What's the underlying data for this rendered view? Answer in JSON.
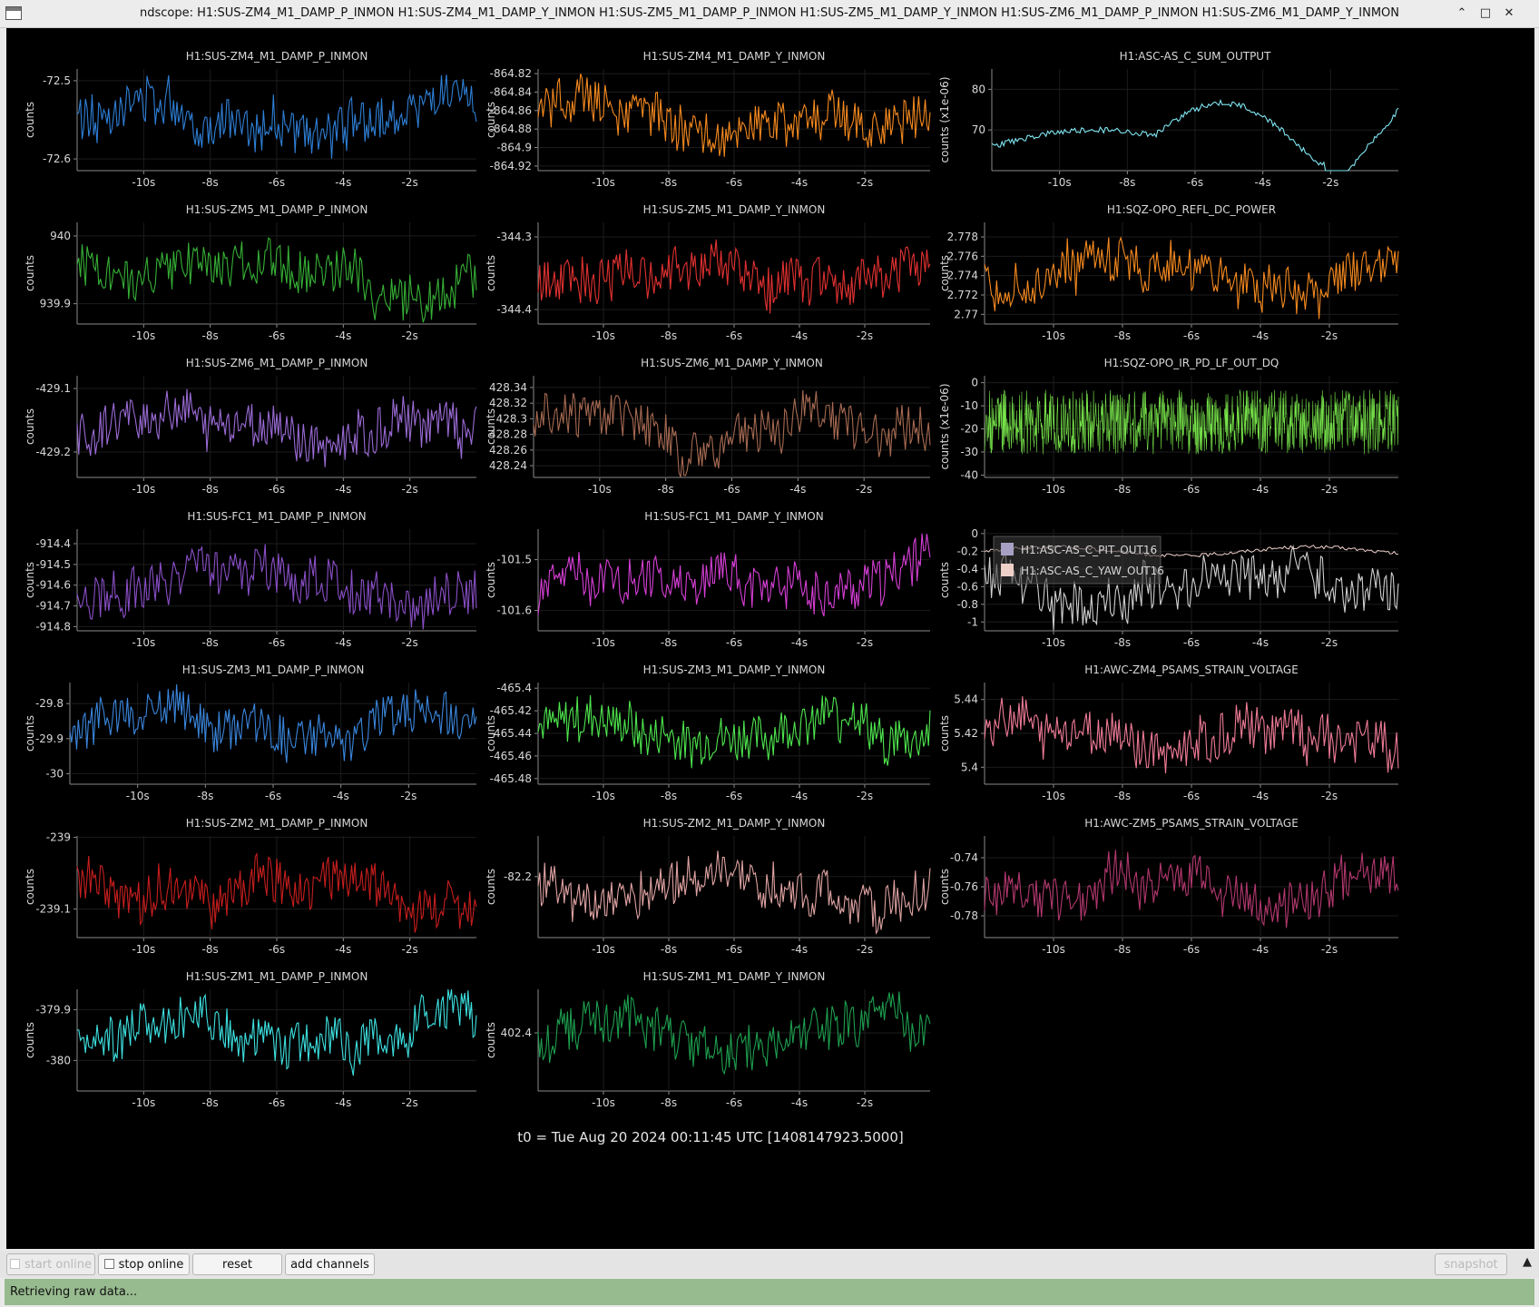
{
  "window": {
    "title": "ndscope: H1:SUS-ZM4_M1_DAMP_P_INMON H1:SUS-ZM4_M1_DAMP_Y_INMON H1:SUS-ZM5_M1_DAMP_P_INMON H1:SUS-ZM5_M1_DAMP_Y_INMON H1:SUS-ZM6_M1_DAMP_P_INMON H1:SUS-ZM6_M1_DAMP_Y_INMON",
    "controls": {
      "minimize": "⌃",
      "maximize": "□",
      "close": "✕"
    }
  },
  "t0_label": "t0 = Tue Aug 20 2024 00:11:45 UTC [1408147923.5000]",
  "toolbar": {
    "start_online": "start online",
    "stop_online": "stop online",
    "reset": "reset",
    "add_channels": "add channels",
    "snapshot": "snapshot",
    "collapse": "▲"
  },
  "status": {
    "text": "Retrieving raw data..."
  },
  "chart_data": [
    {
      "type": "line",
      "title": "H1:SUS-ZM4_M1_DAMP_P_INMON",
      "ylabel": "counts",
      "color": "#2e7fd6",
      "xlim": [
        -12,
        0
      ],
      "ylim": [
        -72.615,
        -72.485
      ],
      "yticks": [
        -72.5,
        -72.6
      ],
      "xticks": [
        "-10s",
        "-8s",
        "-6s",
        "-4s",
        "-2s"
      ],
      "xtick_values": [
        -10,
        -8,
        -6,
        -4,
        -2
      ]
    },
    {
      "type": "line",
      "title": "H1:SUS-ZM4_M1_DAMP_Y_INMON",
      "ylabel": "counts",
      "color": "#f5891f",
      "xlim": [
        -12,
        0
      ],
      "ylim": [
        -864.925,
        -864.815
      ],
      "yticks": [
        -864.82,
        -864.84,
        -864.86,
        -864.88,
        -864.9,
        -864.92
      ],
      "xticks": [
        "-10s",
        "-8s",
        "-6s",
        "-4s",
        "-2s"
      ],
      "xtick_values": [
        -10,
        -8,
        -6,
        -4,
        -2
      ]
    },
    {
      "type": "line",
      "title": "H1:ASC-AS_C_SUM_OUTPUT",
      "ylabel": "counts (x1e-06)",
      "color": "#7fe6f2",
      "xlim": [
        -12,
        0
      ],
      "ylim": [
        60,
        85
      ],
      "yticks": [
        80,
        70
      ],
      "xticks": [
        "-10s",
        "-8s",
        "-6s",
        "-4s",
        "-2s"
      ],
      "xtick_values": [
        -10,
        -8,
        -6,
        -4,
        -2
      ]
    },
    {
      "type": "line",
      "title": "H1:SUS-ZM5_M1_DAMP_P_INMON",
      "ylabel": "counts",
      "color": "#36b036",
      "xlim": [
        -12,
        0
      ],
      "ylim": [
        939.87,
        940.02
      ],
      "yticks": [
        940.0,
        939.9
      ],
      "xticks": [
        "-10s",
        "-8s",
        "-6s",
        "-4s",
        "-2s"
      ],
      "xtick_values": [
        -10,
        -8,
        -6,
        -4,
        -2
      ]
    },
    {
      "type": "line",
      "title": "H1:SUS-ZM5_M1_DAMP_Y_INMON",
      "ylabel": "counts",
      "color": "#e23131",
      "xlim": [
        -12,
        0
      ],
      "ylim": [
        -344.42,
        -344.28
      ],
      "yticks": [
        -344.3,
        -344.4
      ],
      "xticks": [
        "-10s",
        "-8s",
        "-6s",
        "-4s",
        "-2s"
      ],
      "xtick_values": [
        -10,
        -8,
        -6,
        -4,
        -2
      ]
    },
    {
      "type": "line",
      "title": "H1:SQZ-OPO_REFL_DC_POWER",
      "ylabel": "counts",
      "color": "#f5891f",
      "xlim": [
        -12,
        0
      ],
      "ylim": [
        2.769,
        2.7795
      ],
      "yticks": [
        2.778,
        2.776,
        2.774,
        2.772,
        2.77
      ],
      "xticks": [
        "-10s",
        "-8s",
        "-6s",
        "-4s",
        "-2s"
      ],
      "xtick_values": [
        -10,
        -8,
        -6,
        -4,
        -2
      ]
    },
    {
      "type": "line",
      "title": "H1:SUS-ZM6_M1_DAMP_P_INMON",
      "ylabel": "counts",
      "color": "#9b6bd6",
      "xlim": [
        -12,
        0
      ],
      "ylim": [
        -429.24,
        -429.08
      ],
      "yticks": [
        -429.1,
        -429.2
      ],
      "xticks": [
        "-10s",
        "-8s",
        "-6s",
        "-4s",
        "-2s"
      ],
      "xtick_values": [
        -10,
        -8,
        -6,
        -4,
        -2
      ]
    },
    {
      "type": "line",
      "title": "H1:SUS-ZM6_M1_DAMP_Y_INMON",
      "ylabel": "counts",
      "color": "#a66a52",
      "xlim": [
        -12,
        0
      ],
      "ylim": [
        428.225,
        428.355
      ],
      "yticks": [
        428.34,
        428.32,
        428.3,
        428.28,
        428.26,
        428.24
      ],
      "xticks": [
        "-10s",
        "-8s",
        "-6s",
        "-4s",
        "-2s"
      ],
      "xtick_values": [
        -10,
        -8,
        -6,
        -4,
        -2
      ]
    },
    {
      "type": "line",
      "title": "H1:SQZ-OPO_IR_PD_LF_OUT_DQ",
      "ylabel": "counts (x1e-06)",
      "color": "#77e34a",
      "xlim": [
        -12,
        0
      ],
      "ylim": [
        -41,
        3
      ],
      "yticks": [
        0,
        -10,
        -20,
        -30,
        -40
      ],
      "xticks": [
        "-10s",
        "-8s",
        "-6s",
        "-4s",
        "-2s"
      ],
      "xtick_values": [
        -10,
        -8,
        -6,
        -4,
        -2
      ]
    },
    {
      "type": "line",
      "title": "",
      "ylabel": "counts",
      "color": "#cfcfcf",
      "xlim": [
        -12,
        0
      ],
      "ylim": [
        -1.1,
        0.05
      ],
      "yticks": [
        0,
        -0.2,
        -0.4,
        -0.6,
        -0.8,
        -1
      ],
      "xticks": [
        "-10s",
        "-8s",
        "-6s",
        "-4s",
        "-2s"
      ],
      "xtick_values": [
        -10,
        -8,
        -6,
        -4,
        -2
      ],
      "legend": [
        {
          "name": "H1:ASC-AS_C_PIT_OUT16",
          "color": "#a8a0c4"
        },
        {
          "name": "H1:ASC-AS_C_YAW_OUT16",
          "color": "#efd0c9"
        }
      ]
    },
    {
      "type": "line",
      "title": "H1:SUS-FC1_M1_DAMP_P_INMON",
      "ylabel": "counts",
      "color": "#8a4fc7",
      "xlim": [
        -12,
        0
      ],
      "ylim": [
        -914.82,
        -914.33
      ],
      "yticks": [
        -914.4,
        -914.5,
        -914.6,
        -914.7,
        -914.8
      ],
      "xticks": [
        "-10s",
        "-8s",
        "-6s",
        "-4s",
        "-2s"
      ],
      "xtick_values": [
        -10,
        -8,
        -6,
        -4,
        -2
      ]
    },
    {
      "type": "line",
      "title": "H1:SUS-FC1_M1_DAMP_Y_INMON",
      "ylabel": "counts",
      "color": "#d63fd6",
      "xlim": [
        -12,
        0
      ],
      "ylim": [
        -101.64,
        -101.44
      ],
      "yticks": [
        -101.5,
        -101.6
      ],
      "xticks": [
        "-10s",
        "-8s",
        "-6s",
        "-4s",
        "-2s"
      ],
      "xtick_values": [
        -10,
        -8,
        -6,
        -4,
        -2
      ]
    },
    {
      "type": "line",
      "title": "H1:SUS-ZM3_M1_DAMP_P_INMON",
      "ylabel": "counts",
      "color": "#3a86dd",
      "xlim": [
        -12,
        0
      ],
      "ylim": [
        -30.03,
        -29.74
      ],
      "yticks": [
        -29.8,
        -29.9,
        -30.0
      ],
      "xticks": [
        "-10s",
        "-8s",
        "-6s",
        "-4s",
        "-2s"
      ],
      "xtick_values": [
        -10,
        -8,
        -6,
        -4,
        -2
      ]
    },
    {
      "type": "line",
      "title": "H1:SUS-ZM3_M1_DAMP_Y_INMON",
      "ylabel": "counts",
      "color": "#4ee64e",
      "xlim": [
        -12,
        0
      ],
      "ylim": [
        -465.485,
        -465.395
      ],
      "yticks": [
        -465.4,
        -465.42,
        -465.44,
        -465.46,
        -465.48
      ],
      "xticks": [
        "-10s",
        "-8s",
        "-6s",
        "-4s",
        "-2s"
      ],
      "xtick_values": [
        -10,
        -8,
        -6,
        -4,
        -2
      ]
    },
    {
      "type": "line",
      "title": "H1:AWC-ZM4_PSAMS_STRAIN_VOLTAGE",
      "ylabel": "counts",
      "color": "#ef7b96",
      "xlim": [
        -12,
        0
      ],
      "ylim": [
        5.39,
        5.45
      ],
      "yticks": [
        5.44,
        5.42,
        5.4
      ],
      "xticks": [
        "-10s",
        "-8s",
        "-6s",
        "-4s",
        "-2s"
      ],
      "xtick_values": [
        -10,
        -8,
        -6,
        -4,
        -2
      ]
    },
    {
      "type": "line",
      "title": "H1:SUS-ZM2_M1_DAMP_P_INMON",
      "ylabel": "counts",
      "color": "#c81e1e",
      "xlim": [
        -12,
        0
      ],
      "ylim": [
        -239.14,
        -238.998
      ],
      "yticks": [
        -239.0,
        -239.1
      ],
      "xticks": [
        "-10s",
        "-8s",
        "-6s",
        "-4s",
        "-2s"
      ],
      "xtick_values": [
        -10,
        -8,
        -6,
        -4,
        -2
      ]
    },
    {
      "type": "line",
      "title": "H1:SUS-ZM2_M1_DAMP_Y_INMON",
      "ylabel": "counts",
      "color": "#e0a3a3",
      "xlim": [
        -12,
        0
      ],
      "ylim": [
        -82.26,
        -82.16
      ],
      "yticks": [
        -82.2
      ],
      "xticks": [
        "-10s",
        "-8s",
        "-6s",
        "-4s",
        "-2s"
      ],
      "xtick_values": [
        -10,
        -8,
        -6,
        -4,
        -2
      ]
    },
    {
      "type": "line",
      "title": "H1:AWC-ZM5_PSAMS_STRAIN_VOLTAGE",
      "ylabel": "counts",
      "color": "#b2386e",
      "xlim": [
        -12,
        0
      ],
      "ylim": [
        -0.795,
        -0.725
      ],
      "yticks": [
        -0.74,
        -0.76,
        -0.78
      ],
      "xticks": [
        "-10s",
        "-8s",
        "-6s",
        "-4s",
        "-2s"
      ],
      "xtick_values": [
        -10,
        -8,
        -6,
        -4,
        -2
      ]
    },
    {
      "type": "line",
      "title": "H1:SUS-ZM1_M1_DAMP_P_INMON",
      "ylabel": "counts",
      "color": "#3ee0e0",
      "xlim": [
        -12,
        0
      ],
      "ylim": [
        -380.06,
        -379.86
      ],
      "yticks": [
        -379.9,
        -380.0
      ],
      "xticks": [
        "-10s",
        "-8s",
        "-6s",
        "-4s",
        "-2s"
      ],
      "xtick_values": [
        -10,
        -8,
        -6,
        -4,
        -2
      ]
    },
    {
      "type": "line",
      "title": "H1:SUS-ZM1_M1_DAMP_Y_INMON",
      "ylabel": "counts",
      "color": "#1e9e4e",
      "xlim": [
        -12,
        0
      ],
      "ylim": [
        402.2,
        402.55
      ],
      "yticks": [
        402.4
      ],
      "xticks": [
        "-10s",
        "-8s",
        "-6s",
        "-4s",
        "-2s"
      ],
      "xtick_values": [
        -10,
        -8,
        -6,
        -4,
        -2
      ]
    }
  ]
}
